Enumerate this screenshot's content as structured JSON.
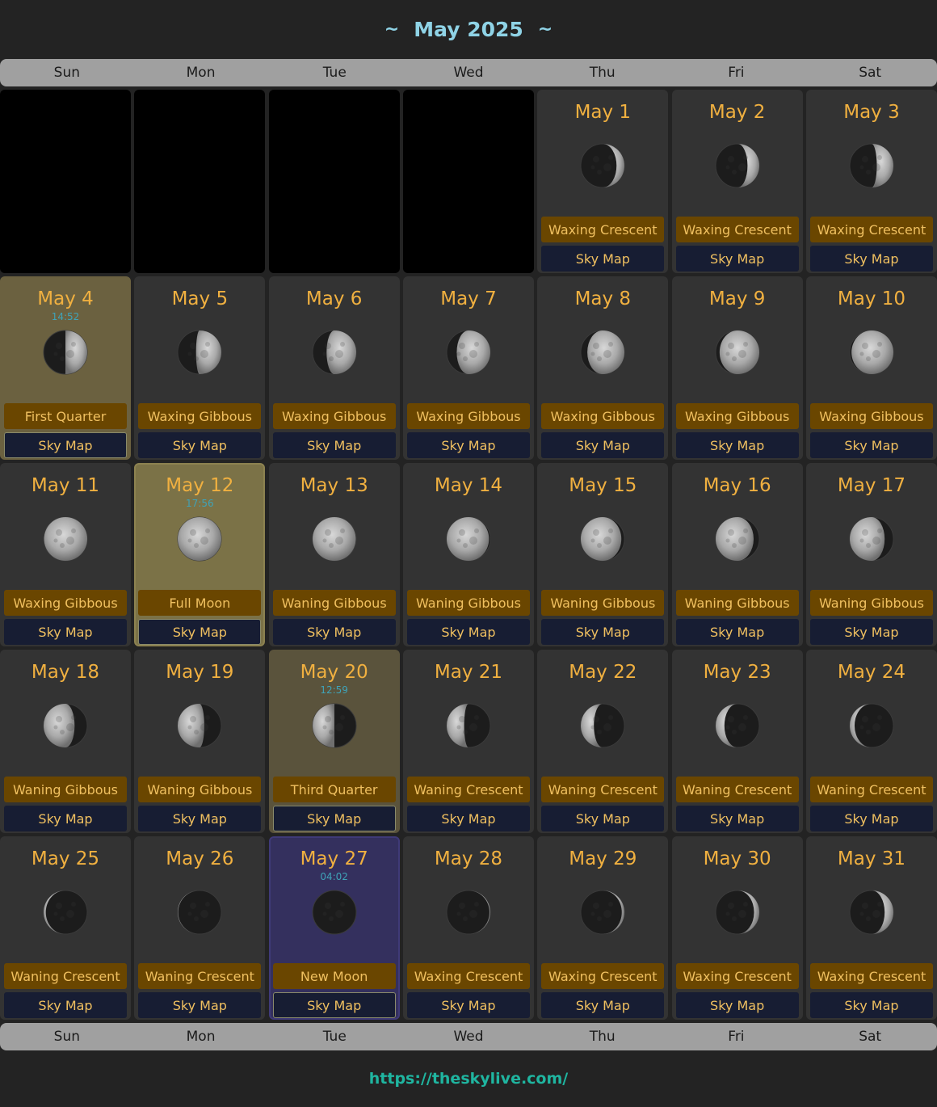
{
  "header": {
    "title": "May 2025",
    "left_tilde": "~",
    "right_tilde": "~"
  },
  "weekdays": [
    "Sun",
    "Mon",
    "Tue",
    "Wed",
    "Thu",
    "Fri",
    "Sat"
  ],
  "colors": {
    "accent": "#f0b040",
    "title": "#8fd3e6",
    "phase_bg": "#6a4600",
    "skymap_bg": "#171d33",
    "link": "#1fb5a0"
  },
  "leading_empty": 4,
  "sky_map_label": "Sky Map",
  "days": [
    {
      "date": "May 1",
      "time": "",
      "phase": "Waxing Crescent",
      "illum": 0.18,
      "waxing": true,
      "hl": ""
    },
    {
      "date": "May 2",
      "time": "",
      "phase": "Waxing Crescent",
      "illum": 0.27,
      "waxing": true,
      "hl": ""
    },
    {
      "date": "May 3",
      "time": "",
      "phase": "Waxing Crescent",
      "illum": 0.38,
      "waxing": true,
      "hl": ""
    },
    {
      "date": "May 4",
      "time": "14:52",
      "phase": "First Quarter",
      "illum": 0.5,
      "waxing": true,
      "hl": "fq"
    },
    {
      "date": "May 5",
      "time": "",
      "phase": "Waxing Gibbous",
      "illum": 0.58,
      "waxing": true,
      "hl": ""
    },
    {
      "date": "May 6",
      "time": "",
      "phase": "Waxing Gibbous",
      "illum": 0.68,
      "waxing": true,
      "hl": ""
    },
    {
      "date": "May 7",
      "time": "",
      "phase": "Waxing Gibbous",
      "illum": 0.77,
      "waxing": true,
      "hl": ""
    },
    {
      "date": "May 8",
      "time": "",
      "phase": "Waxing Gibbous",
      "illum": 0.85,
      "waxing": true,
      "hl": ""
    },
    {
      "date": "May 9",
      "time": "",
      "phase": "Waxing Gibbous",
      "illum": 0.91,
      "waxing": true,
      "hl": ""
    },
    {
      "date": "May 10",
      "time": "",
      "phase": "Waxing Gibbous",
      "illum": 0.96,
      "waxing": true,
      "hl": ""
    },
    {
      "date": "May 11",
      "time": "",
      "phase": "Waxing Gibbous",
      "illum": 0.99,
      "waxing": true,
      "hl": ""
    },
    {
      "date": "May 12",
      "time": "17:56",
      "phase": "Full Moon",
      "illum": 1.0,
      "waxing": true,
      "hl": "full"
    },
    {
      "date": "May 13",
      "time": "",
      "phase": "Waning Gibbous",
      "illum": 0.99,
      "waxing": false,
      "hl": ""
    },
    {
      "date": "May 14",
      "time": "",
      "phase": "Waning Gibbous",
      "illum": 0.97,
      "waxing": false,
      "hl": ""
    },
    {
      "date": "May 15",
      "time": "",
      "phase": "Waning Gibbous",
      "illum": 0.93,
      "waxing": false,
      "hl": ""
    },
    {
      "date": "May 16",
      "time": "",
      "phase": "Waning Gibbous",
      "illum": 0.87,
      "waxing": false,
      "hl": ""
    },
    {
      "date": "May 17",
      "time": "",
      "phase": "Waning Gibbous",
      "illum": 0.8,
      "waxing": false,
      "hl": ""
    },
    {
      "date": "May 18",
      "time": "",
      "phase": "Waning Gibbous",
      "illum": 0.71,
      "waxing": false,
      "hl": ""
    },
    {
      "date": "May 19",
      "time": "",
      "phase": "Waning Gibbous",
      "illum": 0.61,
      "waxing": false,
      "hl": ""
    },
    {
      "date": "May 20",
      "time": "12:59",
      "phase": "Third Quarter",
      "illum": 0.5,
      "waxing": false,
      "hl": "tq"
    },
    {
      "date": "May 21",
      "time": "",
      "phase": "Waning Crescent",
      "illum": 0.4,
      "waxing": false,
      "hl": ""
    },
    {
      "date": "May 22",
      "time": "",
      "phase": "Waning Crescent",
      "illum": 0.3,
      "waxing": false,
      "hl": ""
    },
    {
      "date": "May 23",
      "time": "",
      "phase": "Waning Crescent",
      "illum": 0.2,
      "waxing": false,
      "hl": ""
    },
    {
      "date": "May 24",
      "time": "",
      "phase": "Waning Crescent",
      "illum": 0.11,
      "waxing": false,
      "hl": ""
    },
    {
      "date": "May 25",
      "time": "",
      "phase": "Waning Crescent",
      "illum": 0.05,
      "waxing": false,
      "hl": ""
    },
    {
      "date": "May 26",
      "time": "",
      "phase": "Waning Crescent",
      "illum": 0.01,
      "waxing": false,
      "hl": ""
    },
    {
      "date": "May 27",
      "time": "04:02",
      "phase": "New Moon",
      "illum": 0.0,
      "waxing": true,
      "hl": "new"
    },
    {
      "date": "May 28",
      "time": "",
      "phase": "Waxing Crescent",
      "illum": 0.02,
      "waxing": true,
      "hl": ""
    },
    {
      "date": "May 29",
      "time": "",
      "phase": "Waxing Crescent",
      "illum": 0.06,
      "waxing": true,
      "hl": ""
    },
    {
      "date": "May 30",
      "time": "",
      "phase": "Waxing Crescent",
      "illum": 0.12,
      "waxing": true,
      "hl": ""
    },
    {
      "date": "May 31",
      "time": "",
      "phase": "Waxing Crescent",
      "illum": 0.2,
      "waxing": true,
      "hl": ""
    }
  ],
  "footer": {
    "link": "https://theskylive.com/"
  }
}
